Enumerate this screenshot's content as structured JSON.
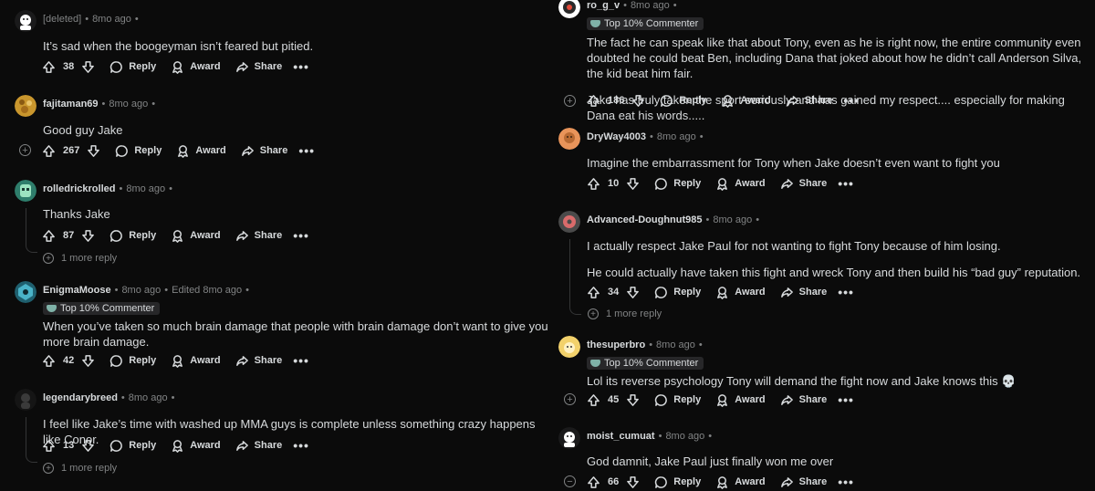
{
  "labels": {
    "reply": "Reply",
    "award": "Award",
    "share": "Share",
    "more": "•••",
    "dot": "•"
  },
  "colors": {
    "background": "#0b0b0b",
    "text": "#d7dadc",
    "muted": "#818384",
    "flair_bg": "#272729"
  },
  "left_column": [
    {
      "user": "[deleted]",
      "time": "8mo ago",
      "body": "It’s sad when the boogeyman isn’t feared but pitied.",
      "score": "38",
      "avatar": "deleted-avatar"
    },
    {
      "user": "fajitaman69",
      "time": "8mo ago",
      "body": "Good guy Jake",
      "score": "267",
      "avatar": "gold-avatar"
    },
    {
      "user": "rolledrickrolled",
      "time": "8mo ago",
      "body": "Thanks Jake",
      "score": "87",
      "avatar": "green-avatar",
      "more_replies": "1 more reply"
    },
    {
      "user": "EnigmaMoose",
      "time": "8mo ago",
      "edited": "Edited 8mo ago",
      "flair": "Top 10% Commenter",
      "body": "When you’ve taken so much brain damage that people with brain damage don’t want to give you more brain damage.",
      "score": "42",
      "avatar": "teal-avatar"
    },
    {
      "user": "legendarybreed",
      "time": "8mo ago",
      "body": "I feel like Jake’s time with washed up MMA guys is complete unless something crazy happens like Conor.",
      "score": "13",
      "avatar": "dark-avatar",
      "more_replies": "1 more reply"
    }
  ],
  "right_column": [
    {
      "user": "ro_g_v",
      "time": "8mo ago",
      "flair": "Top 10% Commenter",
      "body": "The fact he can speak like that about Tony, even as he is right now, the entire community even doubted he could beat Ben, including Dana that joked about how he didn’t call Anderson Silva, the kid beat him fair.",
      "body2": "Jake has truly taken the sport seriously and has gained my respect.... especially for making Dana eat his words.....",
      "score": "186",
      "avatar": "ro-avatar"
    },
    {
      "user": "DryWay4003",
      "time": "8mo ago",
      "body": "Imagine the embarrassment for Tony when Jake doesn’t even want to fight you",
      "score": "10",
      "avatar": "orange-avatar"
    },
    {
      "user": "Advanced-Doughnut985",
      "time": "8mo ago",
      "body": "I actually respect Jake Paul for not wanting to fight Tony because of him losing.",
      "body2": "He could actually have taken this fight and wreck Tony and then build his “bad guy” reputation.",
      "score": "34",
      "avatar": "doughnut-avatar",
      "more_replies": "1 more reply"
    },
    {
      "user": "thesuperbro",
      "time": "8mo ago",
      "flair": "Top 10% Commenter",
      "body": "Lol its reverse psychology Tony will demand the fight now and Jake knows this 💀",
      "score": "45",
      "avatar": "yellow-avatar"
    },
    {
      "user": "moist_cumuat",
      "time": "8mo ago",
      "body": "God damnit, Jake Paul just finally won me over",
      "score": "66",
      "avatar": "white-avatar"
    }
  ]
}
